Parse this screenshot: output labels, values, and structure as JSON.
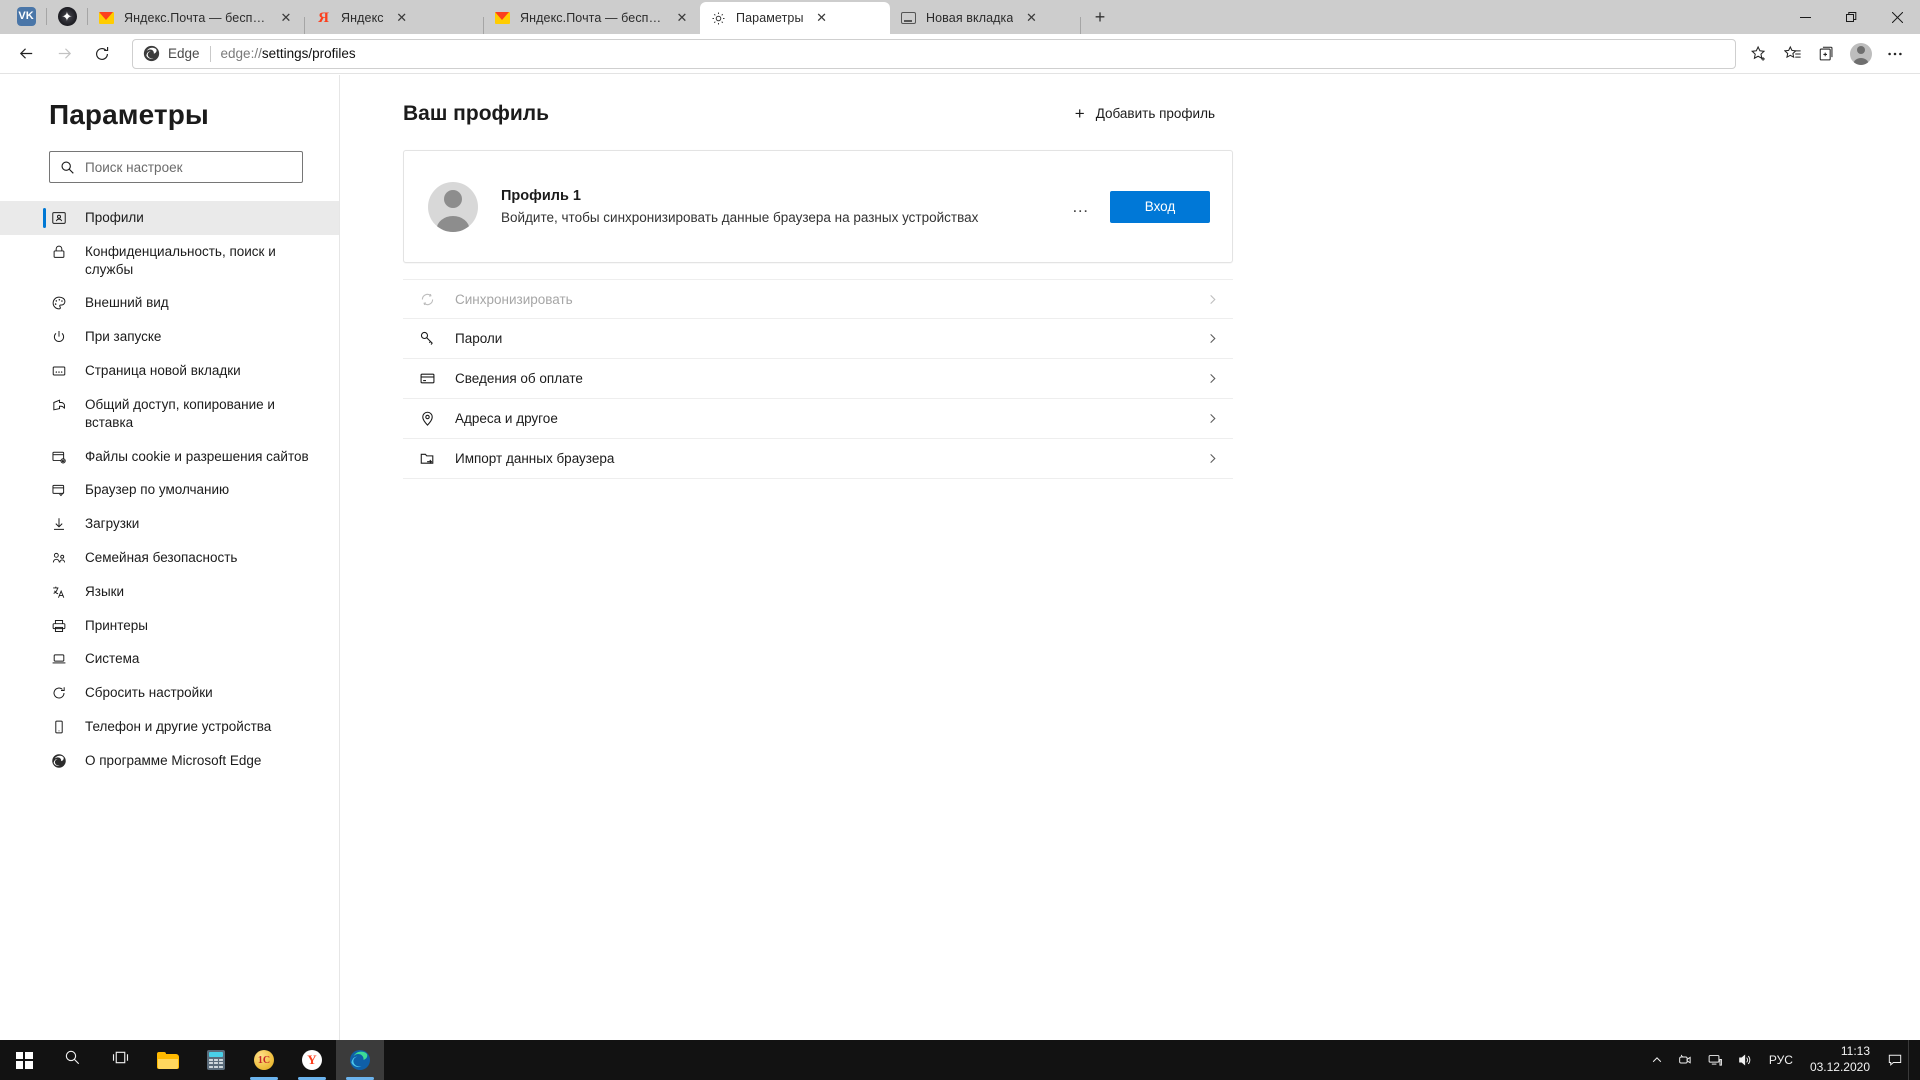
{
  "browser": {
    "window_controls": {
      "minimize": "—",
      "restore": "❐",
      "close": "✕"
    },
    "pinned_tabs": [
      {
        "icon": "vk-icon",
        "label": "VK"
      },
      {
        "icon": "copilot-icon",
        "label": "Copilot"
      }
    ],
    "tabs": [
      {
        "favicon": "yandex-mail-icon",
        "title": "Яндекс.Почта — бесплатная и ",
        "active": false
      },
      {
        "favicon": "yandex-icon",
        "title": "Яндекс",
        "active": false
      },
      {
        "favicon": "yandex-mail-icon",
        "title": "Яндекс.Почта — бесплатная и ",
        "active": false
      },
      {
        "favicon": "gear-icon",
        "title": "Параметры",
        "active": true
      },
      {
        "favicon": "new-tab-icon",
        "title": "Новая вкладка",
        "active": false
      }
    ],
    "new_tab_button": "+",
    "toolbar": {
      "back": "←",
      "forward": "→",
      "refresh": "⟳",
      "brand": "Edge",
      "url_scheme": "edge://",
      "url_path": "settings/profiles",
      "favorite_add": "star-plus-icon",
      "favorites": "favorites-icon",
      "collections": "collections-icon",
      "profile": "profile-avatar-icon",
      "more": "…"
    }
  },
  "settings": {
    "title": "Параметры",
    "search": {
      "placeholder": "Поиск настроек",
      "value": ""
    },
    "nav": [
      {
        "label": "Профили",
        "icon": "profile-card-icon",
        "selected": true
      },
      {
        "label": "Конфиденциальность, поиск и службы",
        "icon": "lock-icon",
        "selected": false
      },
      {
        "label": "Внешний вид",
        "icon": "palette-icon",
        "selected": false
      },
      {
        "label": "При запуске",
        "icon": "power-icon",
        "selected": false
      },
      {
        "label": "Страница новой вкладки",
        "icon": "new-tab-page-icon",
        "selected": false
      },
      {
        "label": "Общий доступ, копирование и вставка",
        "icon": "share-icon",
        "selected": false
      },
      {
        "label": "Файлы cookie и разрешения сайтов",
        "icon": "cookie-permissions-icon",
        "selected": false
      },
      {
        "label": "Браузер по умолчанию",
        "icon": "default-browser-icon",
        "selected": false
      },
      {
        "label": "Загрузки",
        "icon": "download-icon",
        "selected": false
      },
      {
        "label": "Семейная безопасность",
        "icon": "family-safety-icon",
        "selected": false
      },
      {
        "label": "Языки",
        "icon": "languages-icon",
        "selected": false
      },
      {
        "label": "Принтеры",
        "icon": "printer-icon",
        "selected": false
      },
      {
        "label": "Система",
        "icon": "system-icon",
        "selected": false
      },
      {
        "label": "Сбросить настройки",
        "icon": "reset-icon",
        "selected": false
      },
      {
        "label": "Телефон и другие устройства",
        "icon": "phone-icon",
        "selected": false
      },
      {
        "label": "О программе Microsoft Edge",
        "icon": "edge-logo-icon",
        "selected": false
      }
    ]
  },
  "main": {
    "heading": "Ваш профиль",
    "add_profile": "Добавить профиль",
    "add_profile_plus": "+",
    "profile_card": {
      "name": "Профиль 1",
      "description": "Войдите, чтобы синхронизировать данные браузера на разных устройствах",
      "more_menu": "…",
      "signin_button": "Вход",
      "signin_color": "#0078d7"
    },
    "rows": [
      {
        "label": "Синхронизировать",
        "icon": "sync-icon",
        "disabled": true
      },
      {
        "label": "Пароли",
        "icon": "key-icon",
        "disabled": false
      },
      {
        "label": "Сведения об оплате",
        "icon": "credit-card-icon",
        "disabled": false
      },
      {
        "label": "Адреса и другое",
        "icon": "location-pin-icon",
        "disabled": false
      },
      {
        "label": "Импорт данных браузера",
        "icon": "import-icon",
        "disabled": false
      }
    ],
    "chevron": "›"
  },
  "taskbar": {
    "items": [
      {
        "name": "start-button",
        "icon": "windows-logo-icon"
      },
      {
        "name": "search-button",
        "icon": "search-icon"
      },
      {
        "name": "task-view-button",
        "icon": "task-view-icon"
      },
      {
        "name": "file-explorer",
        "icon": "folder-icon"
      },
      {
        "name": "calculator",
        "icon": "calculator-icon"
      },
      {
        "name": "one-c",
        "icon": "1c-icon"
      },
      {
        "name": "yandex-browser",
        "icon": "yandex-icon"
      },
      {
        "name": "microsoft-edge",
        "icon": "edge-logo-icon"
      }
    ],
    "tray": {
      "expand": "⌃",
      "lang": "РУС",
      "time": "11:13",
      "date": "03.12.2020"
    }
  }
}
